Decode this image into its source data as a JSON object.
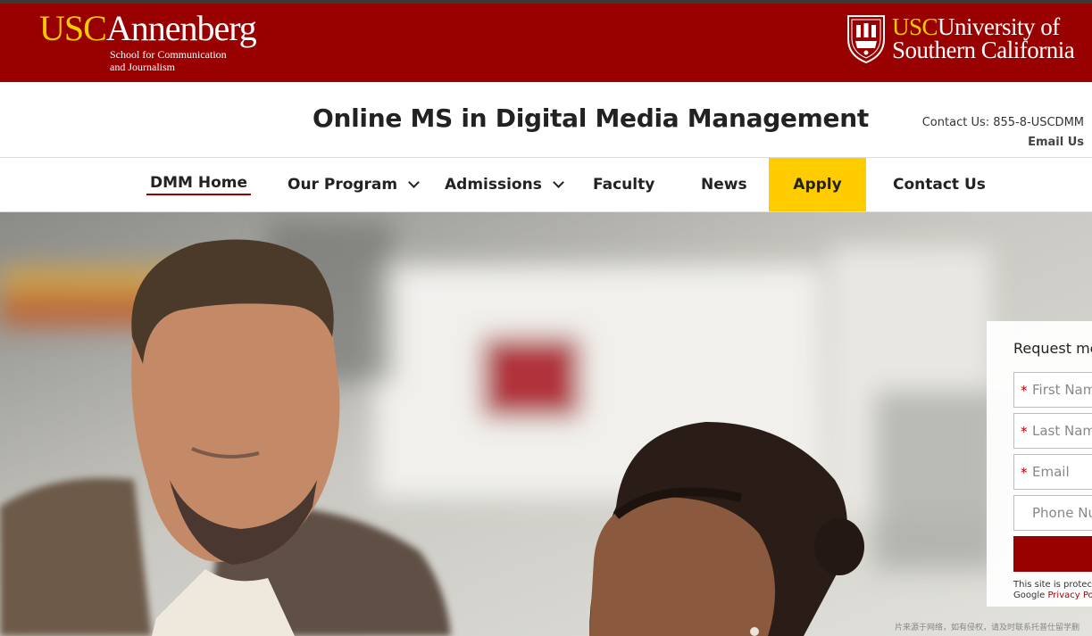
{
  "banner": {
    "left_logo": {
      "usc": "USC",
      "name": "Annenberg",
      "sub_line1": "School for Communication",
      "sub_line2": "and Journalism"
    },
    "right_logo": {
      "usc": "USC",
      "line1": "University of",
      "line2": "Southern California"
    },
    "colors": {
      "cardinal": "#990000",
      "gold": "#FFCC00"
    }
  },
  "header": {
    "title": "Online MS in Digital Media Management",
    "contact_label": "Contact Us: 855-8-USCDMM",
    "email_label": "Email Us"
  },
  "nav": {
    "items": [
      {
        "label": "DMM Home",
        "active": true
      },
      {
        "label": "Our Program",
        "dropdown": true
      },
      {
        "label": "Admissions",
        "dropdown": true
      },
      {
        "label": "Faculty"
      },
      {
        "label": "News"
      },
      {
        "label": "Apply",
        "highlight": true
      },
      {
        "label": "Contact Us"
      }
    ]
  },
  "form": {
    "title": "Request me",
    "fields": {
      "first_name": "First Nam",
      "last_name": "Last Nam",
      "email": "Email",
      "phone": "Phone Nu"
    },
    "required_marker": "*",
    "legal_line1": "This site is protect",
    "legal_line2_prefix": "Google ",
    "legal_link": "Privacy Pol"
  },
  "watermark": "片来源于网络，如有侵权，请及时联系托普仕留学删"
}
